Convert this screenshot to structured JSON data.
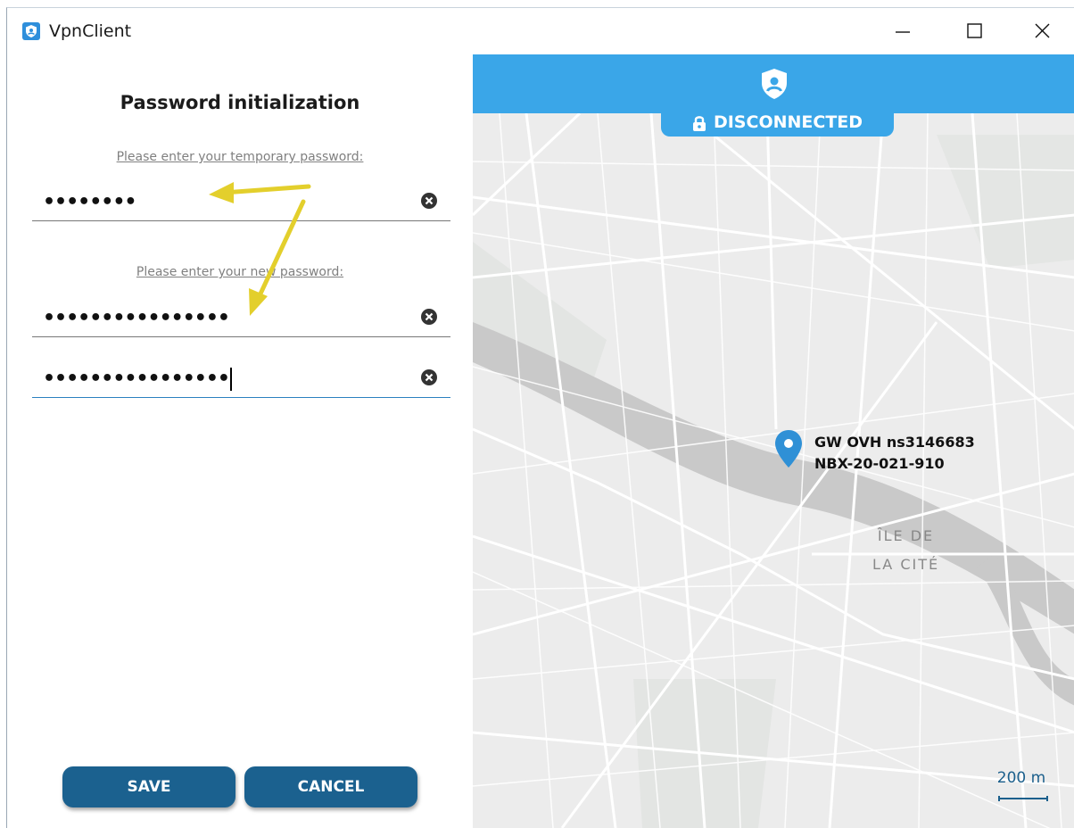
{
  "window": {
    "title": "VpnClient",
    "controls": [
      "minimize",
      "maximize",
      "close"
    ]
  },
  "form": {
    "title": "Password initialization",
    "temp_label": "Please enter your temporary password:",
    "temp_value": "••••••••",
    "new_label": "Please enter your new password:",
    "new_value": "••••••••••••••••",
    "confirm_value": "••••••••••••••••",
    "save_label": "SAVE",
    "cancel_label": "CANCEL"
  },
  "map": {
    "status": "DISCONNECTED",
    "gateway_line1": "GW OVH ns3146683",
    "gateway_line2": "NBX-20-021-910",
    "place_line1": "ÎLE DE",
    "place_line2": "LA CITÉ",
    "scale": "200 m"
  },
  "colors": {
    "accent": "#3aa6e8",
    "button": "#1b618f",
    "annotation_arrow": "#e3cf2c"
  },
  "icons": {
    "app": "shield-icon",
    "clear": "clear-circle-x-icon",
    "status": "shield-user-icon",
    "lock": "lock-icon",
    "marker": "map-pin-icon"
  }
}
